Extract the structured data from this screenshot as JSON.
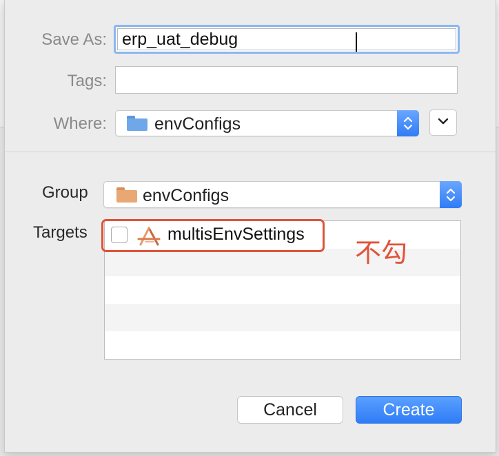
{
  "dialog": {
    "save_as": {
      "label": "Save As:",
      "value": "erp_uat_debug"
    },
    "tags": {
      "label": "Tags:",
      "value": ""
    },
    "where": {
      "label": "Where:",
      "value": "envConfigs"
    },
    "group": {
      "label": "Group",
      "value": "envConfigs"
    },
    "targets": {
      "label": "Targets",
      "items": [
        {
          "name": "multisEnvSettings",
          "checked": false
        }
      ]
    },
    "annotation": "不勾",
    "buttons": {
      "cancel": "Cancel",
      "create": "Create"
    }
  },
  "colors": {
    "accent": "#2f7cf6",
    "annotation": "#e0533a",
    "folder_blue": "#6fa8e8",
    "folder_orange": "#e9a774"
  },
  "icons": [
    "folder-icon",
    "up-down-chevron-icon",
    "chevron-down-icon",
    "xcode-app-icon"
  ]
}
